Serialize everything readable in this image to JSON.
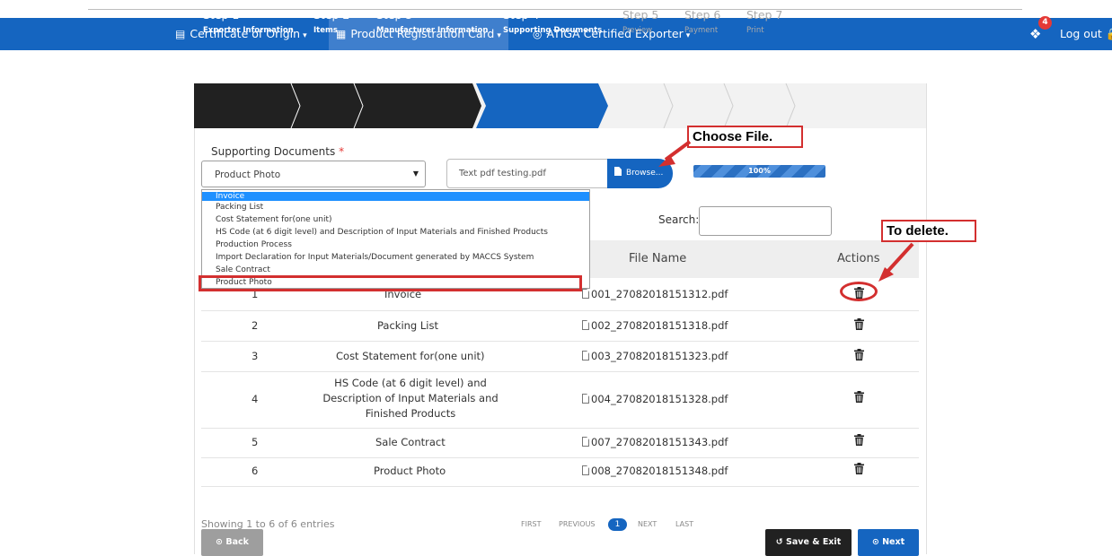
{
  "nav": {
    "items": [
      {
        "label": "Certificate of Origin",
        "icon": "certificate-icon"
      },
      {
        "label": "Product Registration Card",
        "icon": "id-card-icon"
      },
      {
        "label": "ATIGA Certified Exporter",
        "icon": "badge-icon"
      }
    ],
    "notification_count": "4",
    "logout_label": "Log out"
  },
  "steps": [
    {
      "num": "Step 1",
      "label": "Exporter Information",
      "state": "done"
    },
    {
      "num": "Step 2",
      "label": "Items",
      "state": "done"
    },
    {
      "num": "Step 3",
      "label": "Manufacturer Information",
      "state": "done"
    },
    {
      "num": "Step 4",
      "label": "Supporting Documents",
      "state": "current"
    },
    {
      "num": "Step 5",
      "label": "Preview",
      "state": "todo"
    },
    {
      "num": "Step 6",
      "label": "Payment",
      "state": "todo"
    },
    {
      "num": "Step 7",
      "label": "Print",
      "state": "todo"
    }
  ],
  "form": {
    "supporting_docs_label": "Supporting Documents",
    "required_mark": "*",
    "selected_doc_type": "Product Photo",
    "file_name": "Text pdf testing.pdf",
    "browse_label": "Browse...",
    "upload_progress": "100%",
    "dropdown_options": [
      "Invoice",
      "Packing List",
      "Cost Statement for(one unit)",
      "HS Code (at 6 digit level) and Description of Input Materials and Finished Products",
      "Production Process",
      "Import Declaration for Input Materials/Document generated by MACCS System",
      "Sale Contract",
      "Product Photo"
    ]
  },
  "table": {
    "search_label": "Search:",
    "search_value": "",
    "headers": {
      "file_name": "File Name",
      "actions": "Actions"
    },
    "rows": [
      {
        "no": "1",
        "doc": "Invoice",
        "file": "001_27082018151312.pdf"
      },
      {
        "no": "2",
        "doc": "Packing List",
        "file": "002_27082018151318.pdf"
      },
      {
        "no": "3",
        "doc": "Cost Statement for(one unit)",
        "file": "003_27082018151323.pdf"
      },
      {
        "no": "4",
        "doc": "HS Code (at 6 digit level) and Description of Input Materials and Finished Products",
        "file": "004_27082018151328.pdf"
      },
      {
        "no": "5",
        "doc": "Sale Contract",
        "file": "007_27082018151343.pdf"
      },
      {
        "no": "6",
        "doc": "Product Photo",
        "file": "008_27082018151348.pdf"
      }
    ],
    "showing": "Showing 1 to 6 of 6 entries"
  },
  "pagination": {
    "first": "FIRST",
    "previous": "PREVIOUS",
    "current": "1",
    "next": "NEXT",
    "last": "LAST"
  },
  "buttons": {
    "back": "Back",
    "save_exit": "Save & Exit",
    "next": "Next"
  },
  "annotations": {
    "choose_file": "Choose File.",
    "to_delete": "To delete."
  },
  "colors": {
    "primary": "#1565c0",
    "dark": "#212121",
    "annotation": "#d32f2f",
    "badge": "#e53935"
  }
}
